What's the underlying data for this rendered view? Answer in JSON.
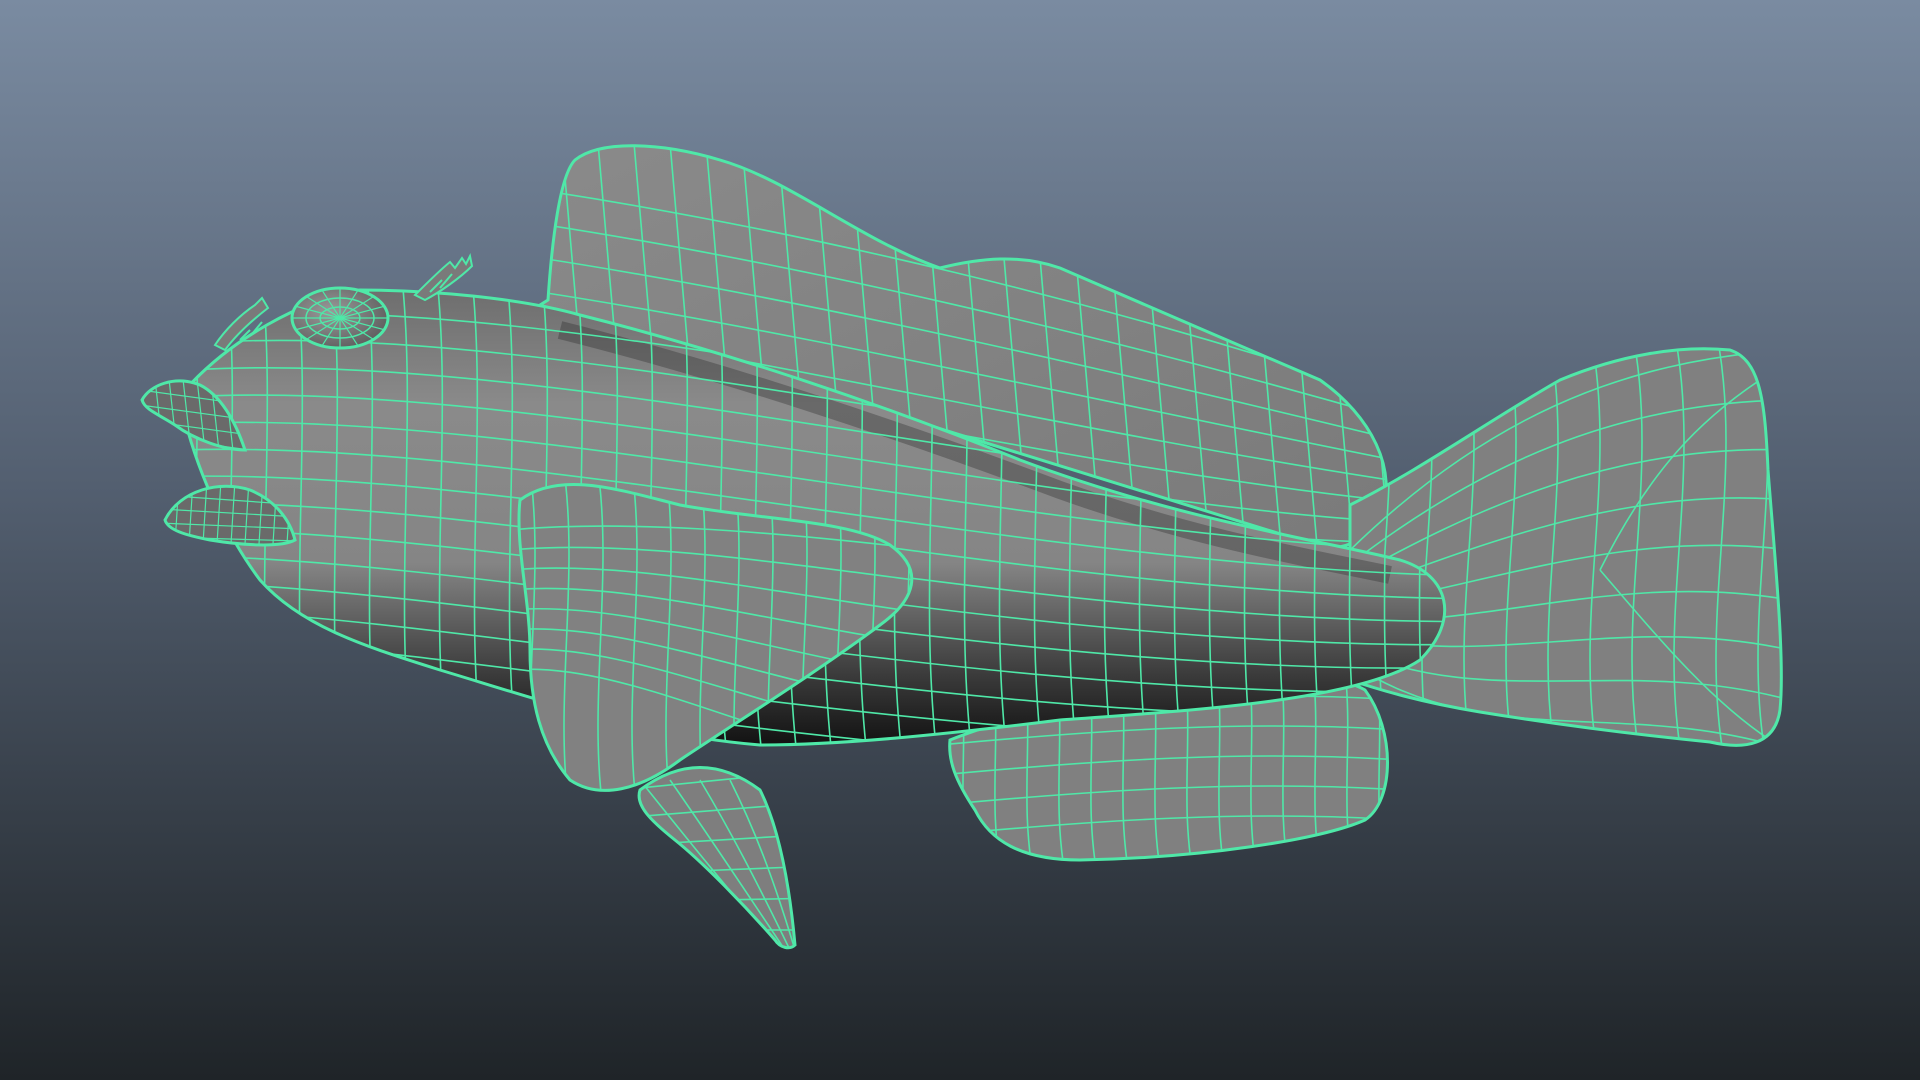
{
  "viewport": {
    "background_top": "#7a8ba1",
    "background_mid": "#535f70",
    "background_bottom": "#1f2428"
  },
  "model": {
    "surface_color": "#808080",
    "surface_shadow": "#1a1a1a",
    "wireframe_color": "#4fe8a8",
    "parts": [
      "dorsal-fin",
      "tail-fin",
      "pelvic-fin",
      "anal-fin",
      "body",
      "pectoral-fin",
      "lower-jaw",
      "upper-jaw",
      "eye",
      "head-spines"
    ]
  }
}
